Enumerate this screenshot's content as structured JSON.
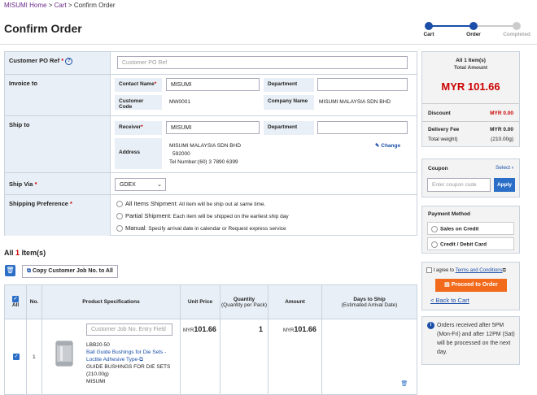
{
  "breadcrumb": {
    "home": "MISUMI Home",
    "cart": "Cart",
    "current": "Confirm Order",
    "sep1": ">",
    "sep2": ">"
  },
  "page_title": "Confirm Order",
  "steps": [
    {
      "label": "Cart",
      "state": "done"
    },
    {
      "label": "Order",
      "state": "current"
    },
    {
      "label": "Completed",
      "state": "pending"
    }
  ],
  "form": {
    "po_label": "Customer PO Ref",
    "po_placeholder": "Customer PO Ref",
    "invoice_label": "Invoice to",
    "invoice": {
      "contact_name_label": "Contact Name",
      "contact_name": "MISUMI",
      "department_label": "Department",
      "department": "",
      "customer_code_label": "Customer Code",
      "customer_code": "MW0001",
      "company_name_label": "Company Name",
      "company_name": "MISUMI MALAYSIA SDN BHD"
    },
    "ship_to_label": "Ship to",
    "ship_to": {
      "receiver_label": "Receiver",
      "receiver": "MISUMI",
      "department_label": "Department",
      "department": "",
      "address_label": "Address",
      "address_line1": "MISUMI MALAYSIA SDN BHD",
      "address_line2": "592000",
      "address_line3": "Tel Number:(60) 3 7890 6399",
      "change_label": "Change"
    },
    "ship_via_label": "Ship Via",
    "ship_via_value": "GDEX",
    "shipping_pref_label": "Shipping Preference",
    "options": [
      {
        "name": "All Items Shipment",
        "desc": ": All item will be ship out at same time."
      },
      {
        "name": "Partial Shipment",
        "desc": ": Each item will be shipped on the earliest ship day"
      },
      {
        "name": "Manual",
        "desc": ": Specify arrival date in calendar or Request express service"
      }
    ]
  },
  "items": {
    "prefix": "All",
    "count": "1",
    "suffix": "Item(s)",
    "copy_button": "Copy Customer Job No. to All"
  },
  "table": {
    "headers": {
      "all": "All",
      "no": "No.",
      "spec": "Product Specifications",
      "unit_price": "Unit Price",
      "qty": "Quantity",
      "qty_sub": "(Quantity per Pack)",
      "amount": "Amount",
      "days": "Days to Ship",
      "days_sub": "(Estimated Arrival Date)"
    },
    "rows": [
      {
        "no": "1",
        "job_placeholder": "Customer Job No. Entry Field",
        "part_no": "LBB20-50",
        "product_link": "Ball Guide Bushings for Die Sets - Loctite Adhesive Type-",
        "product_desc": "GUIDE BUSHINGS FOR DIE SETS",
        "weight": "(210.00g)",
        "brand": "MISUMI",
        "currency": "MYR",
        "unit_price": "101.66",
        "qty": "1",
        "amount": "101.66"
      }
    ]
  },
  "summary": {
    "items_line": "All 1 Item(s)",
    "total_label": "Total Amount",
    "total": "MYR 101.66",
    "discount_label": "Discount",
    "discount": "MYR 0.00",
    "delivery_label": "Delivery Fee",
    "delivery": "MYR 0.00",
    "weight_label": "Total weight)",
    "weight": "(210.00g)"
  },
  "coupon": {
    "label": "Coupon",
    "select": "Select",
    "placeholder": "Enter coupon code",
    "apply": "Apply"
  },
  "payment": {
    "label": "Payment Method",
    "opt1": "Sales on Credit",
    "opt2": "Credit / Debit Card"
  },
  "terms": {
    "prefix": "I agree to",
    "link": "Terms and Conditions"
  },
  "proceed": "Proceed to Order",
  "back": "< Back to Cart",
  "notice": "Orders received after 5PM (Mon-Fri) and after 12PM (Sat) will be processed on the next day.",
  "colors": {
    "accent": "#1a4ea8",
    "price": "#c00000",
    "button": "#f26a1b",
    "header_bg": "#e9eff6"
  }
}
